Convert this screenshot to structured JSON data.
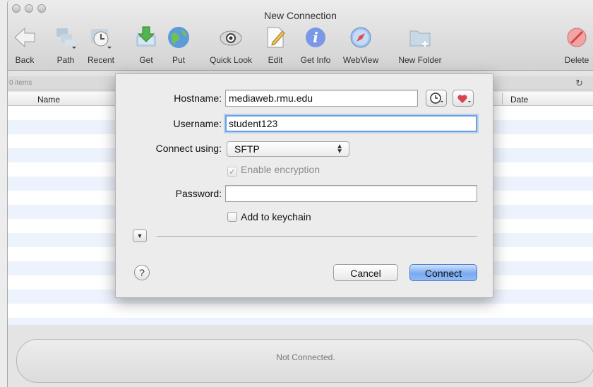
{
  "window": {
    "title": "New Connection"
  },
  "toolbar": {
    "items": [
      {
        "label": "Back",
        "icon": "back-arrow-icon"
      },
      {
        "label": "Path",
        "icon": "path-icon"
      },
      {
        "label": "Recent",
        "icon": "recent-clock-icon"
      },
      {
        "label": "Get",
        "icon": "get-download-icon"
      },
      {
        "label": "Put",
        "icon": "put-globe-icon"
      },
      {
        "label": "Quick Look",
        "icon": "eye-icon"
      },
      {
        "label": "Edit",
        "icon": "edit-pencil-icon"
      },
      {
        "label": "Get Info",
        "icon": "info-icon"
      },
      {
        "label": "WebView",
        "icon": "compass-icon"
      },
      {
        "label": "New Folder",
        "icon": "new-folder-icon"
      },
      {
        "label": "Delete",
        "icon": "delete-icon"
      }
    ]
  },
  "browser": {
    "item_count": "0 items",
    "columns": {
      "name": "Name",
      "date": "Date"
    },
    "status": "Not Connected."
  },
  "dialog": {
    "hostname_label": "Hostname:",
    "hostname_value": "mediaweb.rmu.edu",
    "username_label": "Username:",
    "username_value": "student123",
    "connect_using_label": "Connect using:",
    "connect_using_value": "SFTP",
    "encryption_label": "Enable encryption",
    "encryption_checked": true,
    "password_label": "Password:",
    "password_value": "",
    "keychain_label": "Add to keychain",
    "keychain_checked": false,
    "help_glyph": "?",
    "cancel_label": "Cancel",
    "connect_label": "Connect"
  },
  "colors": {
    "accent_blue": "#79aaf0",
    "focus_ring": "#6aa3e0",
    "favorite_red": "#d9434b"
  }
}
